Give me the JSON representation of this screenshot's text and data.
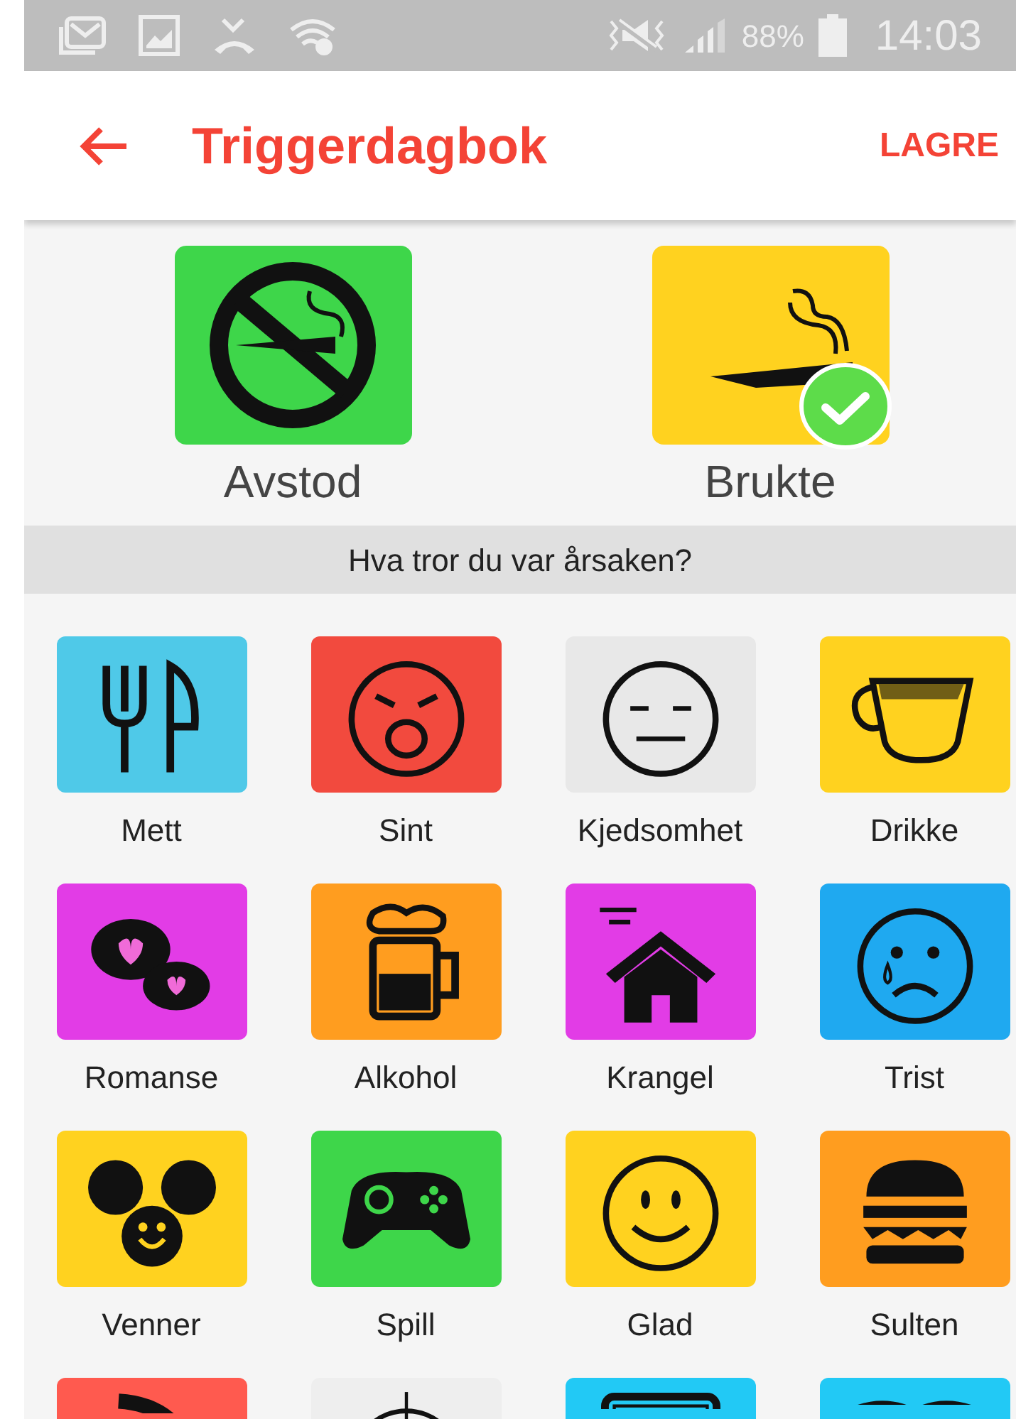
{
  "status_bar": {
    "battery": "88%",
    "time": "14:03"
  },
  "app_bar": {
    "title": "Triggerdagbok",
    "action": "LAGRE"
  },
  "choices": [
    {
      "label": "Avstod",
      "color": "#3ed64a",
      "selected": false
    },
    {
      "label": "Brukte",
      "color": "#ffd21f",
      "selected": true
    }
  ],
  "section_header": "Hva tror du var årsaken?",
  "reasons": [
    {
      "label": "Mett",
      "color": "#4fc9e8"
    },
    {
      "label": "Sint",
      "color": "#f24a3e"
    },
    {
      "label": "Kjedsomhet",
      "color": "#e8e8e8"
    },
    {
      "label": "Drikke",
      "color": "#ffd21f"
    },
    {
      "label": "Romanse",
      "color": "#e23ce6"
    },
    {
      "label": "Alkohol",
      "color": "#ff9d1f"
    },
    {
      "label": "Krangel",
      "color": "#e23ce6"
    },
    {
      "label": "Trist",
      "color": "#1fa9f0"
    },
    {
      "label": "Venner",
      "color": "#ffd21f"
    },
    {
      "label": "Spill",
      "color": "#3ed64a"
    },
    {
      "label": "Glad",
      "color": "#ffd21f"
    },
    {
      "label": "Sulten",
      "color": "#ff9d1f"
    },
    {
      "color": "#ff5a4f"
    },
    {
      "color": "#eeeeee"
    },
    {
      "color": "#22c9f5"
    },
    {
      "color": "#22c9f5"
    }
  ]
}
